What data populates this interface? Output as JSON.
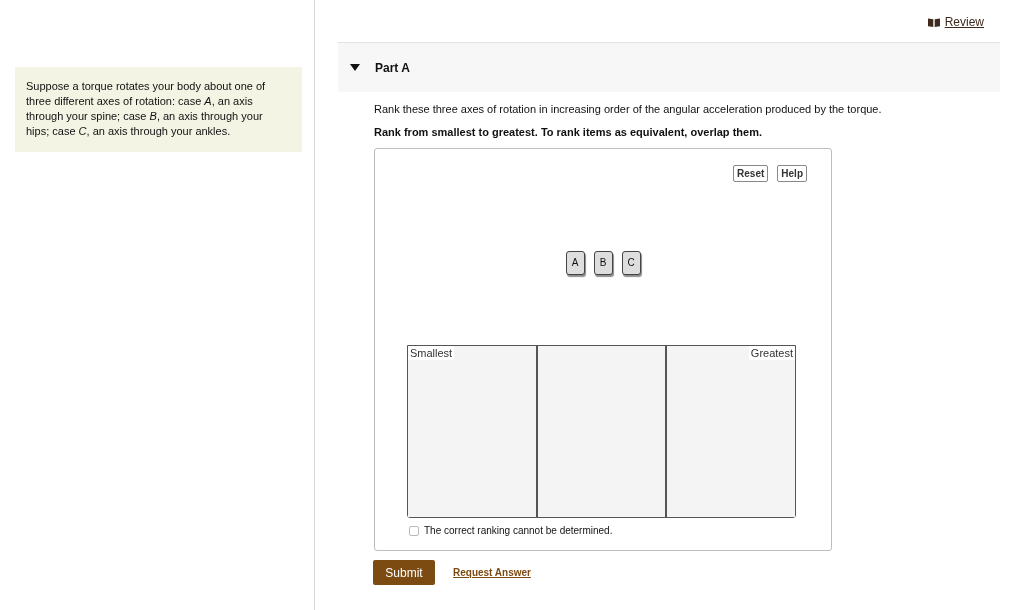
{
  "header": {
    "review_link": "Review"
  },
  "problem": {
    "text": "Suppose a torque rotates your body about one of three different axes of rotation: case *A*, an axis through your spine; case *B*, an axis through your hips; case *C*, an axis through your ankles."
  },
  "part": {
    "title": "Part A",
    "expanded": true,
    "question": "Rank these three axes of rotation in increasing order of the angular acceleration produced by the torque.",
    "instruction": "Rank from smallest to greatest. To rank items as equivalent, overlap them.",
    "ranking": {
      "buttons": [
        "Reset",
        "Help"
      ],
      "items": [
        "A",
        "B",
        "C"
      ],
      "bins": [
        {
          "kind": "low",
          "label": "Smallest"
        },
        {
          "kind": "middle"
        },
        {
          "kind": "high",
          "label": "Greatest"
        }
      ],
      "indeterminate": {
        "label": "The correct ranking cannot be determined.",
        "checked": false
      }
    },
    "actions": {
      "submit": "Submit",
      "request_answer": "Request Answer"
    }
  }
}
